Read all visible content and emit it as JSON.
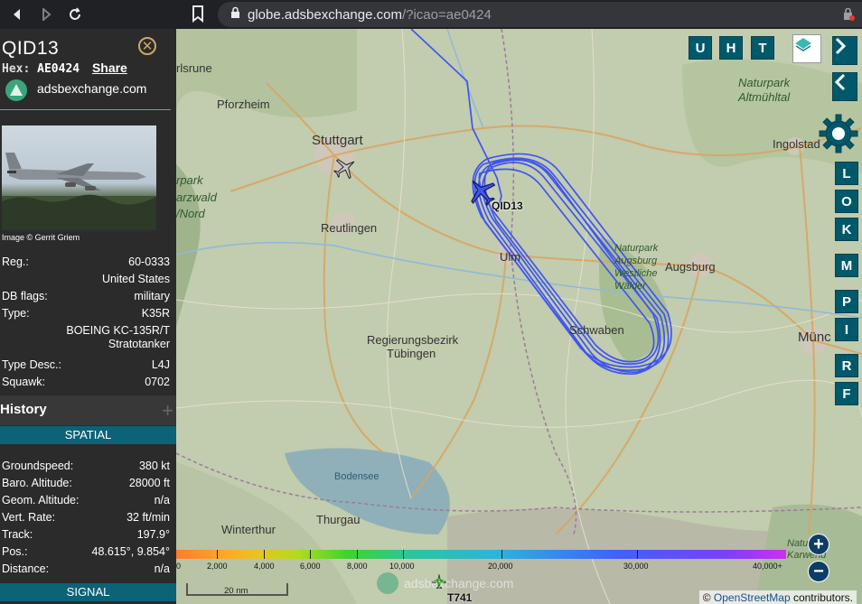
{
  "browser": {
    "url_host": "globe.adsbexchange.com",
    "url_path": "/?icao=ae0424"
  },
  "sidebar": {
    "callsign": "QID13",
    "hex_label": "Hex:",
    "hex_value": "AE0424",
    "share_label": "Share",
    "site_name": "adsbexchange.com",
    "photo_credit": "Image © Gerrit Griem",
    "details": [
      {
        "key": "Reg.:",
        "value": "60-0333"
      },
      {
        "key": "",
        "value": "United States"
      },
      {
        "key": "DB flags:",
        "value": "military"
      },
      {
        "key": "Type:",
        "value": "K35R"
      },
      {
        "key": "",
        "value": "BOEING KC-135R/T Stratotanker"
      },
      {
        "key": "Type Desc.:",
        "value": "L4J"
      },
      {
        "key": "Squawk:",
        "value": "0702"
      }
    ],
    "history_label": "History",
    "spatial_label": "SPATIAL",
    "spatial": [
      {
        "key": "Groundspeed:",
        "value": "380 kt"
      },
      {
        "key": "Baro. Altitude:",
        "value": "28000 ft"
      },
      {
        "key": "Geom. Altitude:",
        "value": "n/a"
      },
      {
        "key": "Vert. Rate:",
        "value": "32 ft/min"
      },
      {
        "key": "Track:",
        "value": "197.9°"
      },
      {
        "key": "Pos.:",
        "value": "48.615°, 9.854°"
      },
      {
        "key": "Distance:",
        "value": "n/a"
      }
    ],
    "signal_label": "SIGNAL"
  },
  "map": {
    "labels": {
      "stuttgart": "Stuttgart",
      "pforzheim": "Pforzheim",
      "reutlingen": "Reutlingen",
      "augsburg": "Augsburg",
      "ingolstadt": "Ingolstad",
      "munchen": "Münc",
      "winterthur": "Winterthur",
      "thurgau": "Thurgau",
      "bodensee": "Bodensee",
      "regbez": "Regierungsbezirk",
      "tubingen": "Tübingen",
      "schwaben": "Schwaben",
      "ulm": "Ulm",
      "karlsruhe": "rlsrune",
      "naturpark_altmuehltal": "Naturpark Altmühltal",
      "naturpark_augsburg": "Naturpark Augsburg Westliche Wälder",
      "schwarzwald": "arzwald",
      "schwarzwald_nord": "/Nord",
      "naturpark_karwendel": "Natur Karwend",
      "naturpark_left": "rpark"
    },
    "aircraft_label": "QID13",
    "other_aircraft_label": "T741",
    "watermark": "adsbexchange.com",
    "top_buttons": [
      "U",
      "H",
      "T"
    ],
    "right_buttons": [
      "L",
      "O",
      "K",
      "M",
      "P",
      "I",
      "R",
      "F"
    ],
    "altitude_legend": [
      "0",
      "2,000",
      "4,000",
      "6,000",
      "8,000",
      "10,000",
      "20,000",
      "30,000",
      "40,000+"
    ],
    "scale_label": "20 nm",
    "attribution_prefix": "© ",
    "attribution_link": "OpenStreetMap",
    "attribution_suffix": " contributors.",
    "zoom_in": "+",
    "zoom_out": "−",
    "colors": {
      "track": "#3f55f0",
      "buttons": "#00596b"
    }
  }
}
